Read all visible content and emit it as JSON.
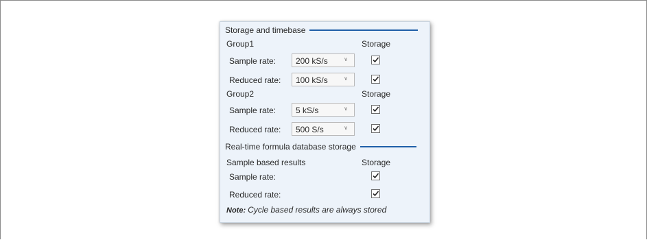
{
  "panel": {
    "section1": {
      "title": "Storage and timebase"
    },
    "group1": {
      "title": "Group1",
      "storage_header": "Storage",
      "rows": [
        {
          "label": "Sample rate:",
          "value": "200 kS/s",
          "checked": true
        },
        {
          "label": "Reduced rate:",
          "value": "100 kS/s",
          "checked": true
        }
      ]
    },
    "group2": {
      "title": "Group2",
      "storage_header": "Storage",
      "rows": [
        {
          "label": "Sample rate:",
          "value": "5 kS/s",
          "checked": true
        },
        {
          "label": "Reduced rate:",
          "value": "500 S/s",
          "checked": true
        }
      ]
    },
    "section2": {
      "title": "Real-time formula database storage"
    },
    "sample_based": {
      "title": "Sample based results",
      "storage_header": "Storage",
      "rows": [
        {
          "label": "Sample rate:",
          "checked": true
        },
        {
          "label": "Reduced rate:",
          "checked": true
        }
      ]
    },
    "note": {
      "prefix": "Note:",
      "text": "Cycle based results are always stored"
    }
  },
  "colors": {
    "panel_bg": "#edf3fa",
    "section_line": "#1f5fa8"
  },
  "icons": {
    "dropdown": "chevron-down-icon",
    "check": "checkmark-icon"
  }
}
